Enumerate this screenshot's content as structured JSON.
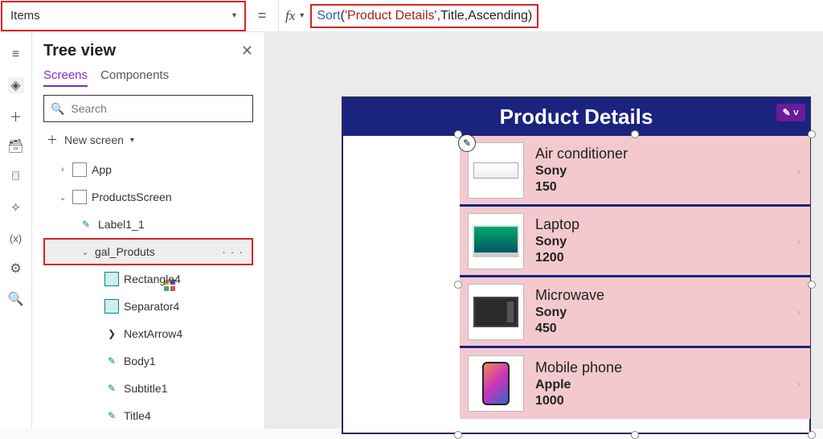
{
  "topbar": {
    "property": "Items",
    "equals": "=",
    "fx": "fx",
    "formula": {
      "fn": "Sort",
      "open": "(",
      "arg1": "'Product Details'",
      "sep1": ",",
      "arg2": "Title",
      "sep2": ",",
      "arg3": "Ascending",
      "close": ")"
    }
  },
  "rail": {
    "hamburger": "≡",
    "tree": "◈",
    "insert": "＋",
    "data": "🗃",
    "media": "⌼",
    "power": "⟡",
    "vars": "(x)",
    "tools": "⚙",
    "search": "🔍"
  },
  "tree": {
    "title": "Tree view",
    "close": "✕",
    "tabs": {
      "screens": "Screens",
      "components": "Components"
    },
    "search_placeholder": "Search",
    "new_screen": "New screen",
    "items": {
      "app": "App",
      "screen": "ProductsScreen",
      "label": "Label1_1",
      "gallery": "gal_Produts",
      "rect": "Rectangle4",
      "sep": "Separator4",
      "arrow": "NextArrow4",
      "body": "Body1",
      "subtitle": "Subtitle1",
      "titlec": "Title4"
    },
    "more": "· · ·"
  },
  "app": {
    "header": "Product Details",
    "badge": "✎ ˅",
    "pencil": "✎",
    "products": [
      {
        "title": "Air conditioner",
        "subtitle": "Sony",
        "body": "150",
        "img": "ac"
      },
      {
        "title": "Laptop",
        "subtitle": "Sony",
        "body": "1200",
        "img": "laptop"
      },
      {
        "title": "Microwave",
        "subtitle": "Sony",
        "body": "450",
        "img": "microwave"
      },
      {
        "title": "Mobile phone",
        "subtitle": "Apple",
        "body": "1000",
        "img": "phone"
      }
    ],
    "arrow": "›"
  }
}
